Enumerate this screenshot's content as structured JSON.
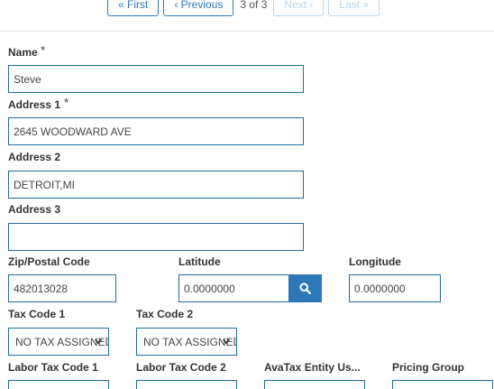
{
  "pager": {
    "first_label": "« First",
    "previous_label": "‹ Previous",
    "position_text": "3 of 3",
    "next_label": "Next ›",
    "last_label": "Last »"
  },
  "form": {
    "name": {
      "label": "Name",
      "required_mark": "*",
      "value": "Steve"
    },
    "address1": {
      "label": "Address 1",
      "required_mark": "*",
      "value": "2645 WOODWARD AVE"
    },
    "address2": {
      "label": "Address 2",
      "value": "DETROIT,MI"
    },
    "address3": {
      "label": "Address 3",
      "value": ""
    },
    "zip": {
      "label": "Zip/Postal Code",
      "value": "482013028"
    },
    "latitude": {
      "label": "Latitude",
      "value": "0.0000000"
    },
    "longitude": {
      "label": "Longitude",
      "value": "0.0000000"
    },
    "tax_code_1": {
      "label": "Tax Code 1",
      "selected": "NO TAX ASSIGNED"
    },
    "tax_code_2": {
      "label": "Tax Code 2",
      "selected": "NO TAX ASSIGNED"
    },
    "labor_tax_code_1": {
      "label": "Labor Tax Code 1",
      "selected": ""
    },
    "labor_tax_code_2": {
      "label": "Labor Tax Code 2",
      "selected": ""
    },
    "avatax_entity_use": {
      "label": "AvaTax Entity Us...",
      "selected": ""
    },
    "pricing_group": {
      "label": "Pricing Group",
      "selected": ""
    }
  },
  "icons": {
    "search": "search-icon",
    "dropdown": "chevron-down-icon"
  },
  "colors": {
    "accent": "#2b77b8",
    "input_border": "#1f6e9c",
    "disabled": "#b9d3ea"
  }
}
